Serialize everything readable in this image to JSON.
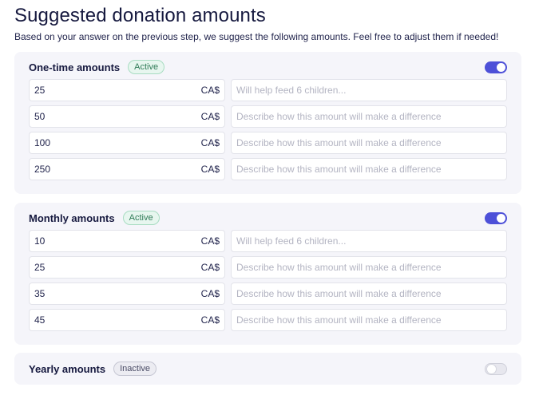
{
  "page": {
    "title": "Suggested donation amounts",
    "subtitle": "Based on your answer on the previous step, we suggest the following amounts. Feel free to adjust them if needed!"
  },
  "colors": {
    "accent": "#4d50d8",
    "section_bg": "#f5f5fa",
    "active_badge": "#e7f6ef",
    "inactive_badge": "#ececf2"
  },
  "sections": [
    {
      "title": "One-time amounts",
      "status": "Active",
      "toggle_on": true,
      "rows": [
        {
          "amount": "25",
          "currency": "CA$",
          "description": "",
          "placeholder": "Will help feed 6 children..."
        },
        {
          "amount": "50",
          "currency": "CA$",
          "description": "",
          "placeholder": "Describe how this amount will make a difference"
        },
        {
          "amount": "100",
          "currency": "CA$",
          "description": "",
          "placeholder": "Describe how this amount will make a difference"
        },
        {
          "amount": "250",
          "currency": "CA$",
          "description": "",
          "placeholder": "Describe how this amount will make a difference"
        }
      ]
    },
    {
      "title": "Monthly amounts",
      "status": "Active",
      "toggle_on": true,
      "rows": [
        {
          "amount": "10",
          "currency": "CA$",
          "description": "",
          "placeholder": "Will help feed 6 children..."
        },
        {
          "amount": "25",
          "currency": "CA$",
          "description": "",
          "placeholder": "Describe how this amount will make a difference"
        },
        {
          "amount": "35",
          "currency": "CA$",
          "description": "",
          "placeholder": "Describe how this amount will make a difference"
        },
        {
          "amount": "45",
          "currency": "CA$",
          "description": "",
          "placeholder": "Describe how this amount will make a difference"
        }
      ]
    },
    {
      "title": "Yearly amounts",
      "status": "Inactive",
      "toggle_on": false,
      "rows": []
    }
  ]
}
